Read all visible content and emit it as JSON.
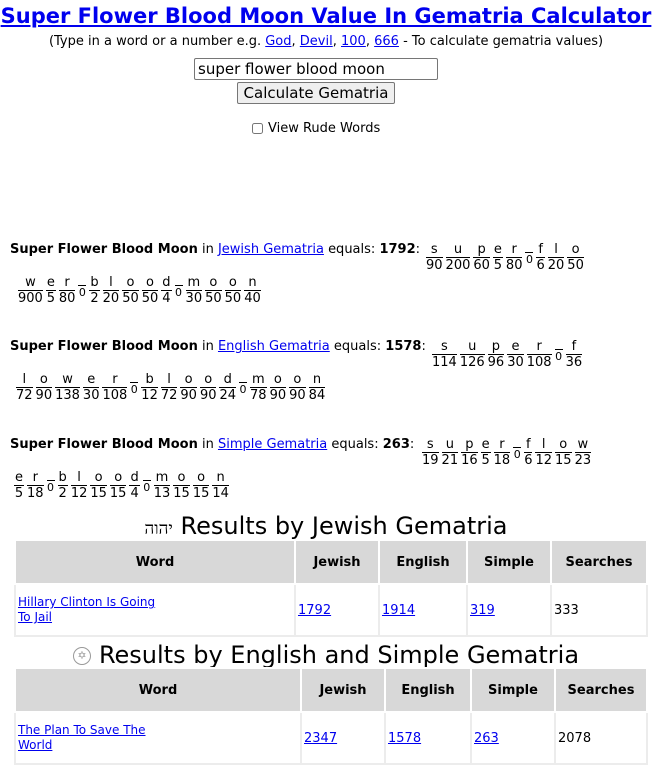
{
  "header": {
    "title": "Super Flower Blood Moon Value In Gematria Calculator",
    "hint_prefix": "(Type in a word or a number e.g.",
    "hint_links": [
      "God",
      "Devil",
      "100",
      "666"
    ],
    "hint_sep": ",",
    "hint_suffix": "- To calculate gematria values)"
  },
  "search": {
    "value": "super flower blood moon"
  },
  "calculate_button": "Calculate Gematria",
  "rude_words_label": "View Rude Words",
  "ciphers": [
    {
      "phrase": "Super Flower Blood Moon",
      "in_text": "in",
      "cipher_name": "Jewish Gematria",
      "equals_text": "equals:",
      "total": "1792",
      "colon": ":",
      "letters": [
        [
          "s",
          "90"
        ],
        [
          "u",
          "200"
        ],
        [
          "p",
          "60"
        ],
        [
          "e",
          "5"
        ],
        [
          "r",
          "80"
        ],
        [
          " ",
          "0"
        ],
        [
          "f",
          "6"
        ],
        [
          "l",
          "20"
        ],
        [
          "o",
          "50"
        ],
        [
          "w",
          "900"
        ],
        [
          "e",
          "5"
        ],
        [
          "r",
          "80"
        ],
        [
          " ",
          "0"
        ],
        [
          "b",
          "2"
        ],
        [
          "l",
          "20"
        ],
        [
          "o",
          "50"
        ],
        [
          "o",
          "50"
        ],
        [
          "d",
          "4"
        ],
        [
          " ",
          "0"
        ],
        [
          "m",
          "30"
        ],
        [
          "o",
          "50"
        ],
        [
          "o",
          "50"
        ],
        [
          "n",
          "40"
        ]
      ]
    },
    {
      "phrase": "Super Flower Blood Moon",
      "in_text": "in",
      "cipher_name": "English Gematria",
      "equals_text": "equals:",
      "total": "1578",
      "colon": ":",
      "letters": [
        [
          "s",
          "114"
        ],
        [
          "u",
          "126"
        ],
        [
          "p",
          "96"
        ],
        [
          "e",
          "30"
        ],
        [
          "r",
          "108"
        ],
        [
          " ",
          "0"
        ],
        [
          "f",
          "36"
        ],
        [
          "l",
          "72"
        ],
        [
          "o",
          "90"
        ],
        [
          "w",
          "138"
        ],
        [
          "e",
          "30"
        ],
        [
          "r",
          "108"
        ],
        [
          " ",
          "0"
        ],
        [
          "b",
          "12"
        ],
        [
          "l",
          "72"
        ],
        [
          "o",
          "90"
        ],
        [
          "o",
          "90"
        ],
        [
          "d",
          "24"
        ],
        [
          " ",
          "0"
        ],
        [
          "m",
          "78"
        ],
        [
          "o",
          "90"
        ],
        [
          "o",
          "90"
        ],
        [
          "n",
          "84"
        ]
      ]
    },
    {
      "phrase": "Super Flower Blood Moon",
      "in_text": "in",
      "cipher_name": "Simple Gematria",
      "equals_text": "equals:",
      "total": "263",
      "colon": ":",
      "letters": [
        [
          "s",
          "19"
        ],
        [
          "u",
          "21"
        ],
        [
          "p",
          "16"
        ],
        [
          "e",
          "5"
        ],
        [
          "r",
          "18"
        ],
        [
          " ",
          "0"
        ],
        [
          "f",
          "6"
        ],
        [
          "l",
          "12"
        ],
        [
          "o",
          "15"
        ],
        [
          "w",
          "23"
        ],
        [
          "e",
          "5"
        ],
        [
          "r",
          "18"
        ],
        [
          " ",
          "0"
        ],
        [
          "b",
          "2"
        ],
        [
          "l",
          "12"
        ],
        [
          "o",
          "15"
        ],
        [
          "o",
          "15"
        ],
        [
          "d",
          "4"
        ],
        [
          " ",
          "0"
        ],
        [
          "m",
          "13"
        ],
        [
          "o",
          "15"
        ],
        [
          "o",
          "15"
        ],
        [
          "n",
          "14"
        ]
      ]
    }
  ],
  "jewish_results": {
    "hebrew_glyph": "יהוה",
    "title": "Results by Jewish Gematria",
    "columns": [
      "Word",
      "Jewish",
      "English",
      "Simple",
      "Searches"
    ],
    "rows": [
      {
        "word_line1": "Hillary Clinton Is Going",
        "word_line2": "To Jail",
        "jewish": "1792",
        "english": "1914",
        "simple": "319",
        "searches": "333"
      }
    ]
  },
  "english_results": {
    "icon": "pentagram-icon",
    "title": "Results by English and Simple Gematria",
    "columns": [
      "Word",
      "Jewish",
      "English",
      "Simple",
      "Searches"
    ],
    "rows": [
      {
        "word_line1": "The Plan To Save The",
        "word_line2": "World",
        "jewish": "2347",
        "english": "1578",
        "simple": "263",
        "searches": "2078"
      }
    ]
  },
  "colors": {
    "link": "#0000ee",
    "header_bg": "#d8d8d8"
  }
}
